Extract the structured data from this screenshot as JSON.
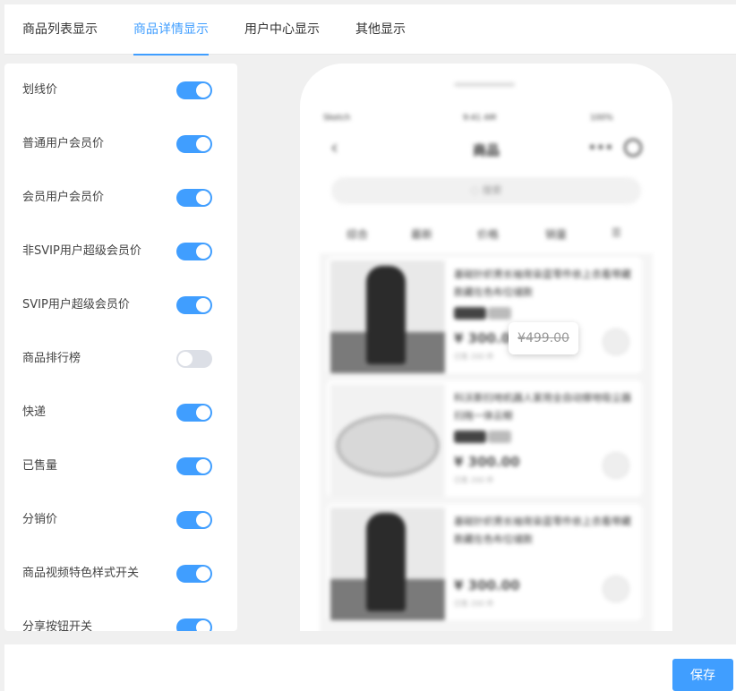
{
  "tabs": [
    {
      "label": "商品列表显示",
      "active": false
    },
    {
      "label": "商品详情显示",
      "active": true
    },
    {
      "label": "用户中心显示",
      "active": false
    },
    {
      "label": "其他显示",
      "active": false
    }
  ],
  "settings": [
    {
      "label": "划线价",
      "on": true
    },
    {
      "label": "普通用户会员价",
      "on": true
    },
    {
      "label": "会员用户会员价",
      "on": true
    },
    {
      "label": "非SVIP用户超级会员价",
      "on": true
    },
    {
      "label": "SVIP用户超级会员价",
      "on": true
    },
    {
      "label": "商品排行榜",
      "on": false
    },
    {
      "label": "快递",
      "on": true
    },
    {
      "label": "已售量",
      "on": true
    },
    {
      "label": "分销价",
      "on": true
    },
    {
      "label": "商品视频特色样式开关",
      "on": true
    },
    {
      "label": "分享按钮开关",
      "on": true
    }
  ],
  "preview": {
    "status_left": "Sketch",
    "status_time": "9:41 AM",
    "status_battery": "100%",
    "nav_title": "商品",
    "search_placeholder": "搜索",
    "sort_items": [
      "综合",
      "最新",
      "价格",
      "销量"
    ],
    "cards": [
      {
        "title": "基础针织男长袖背染蓝零件依上衣看带藏款藏在色布位储款",
        "price": "¥ 300.00",
        "sub": "已售 200 件"
      },
      {
        "title": "科沃斯扫地机器人家用全自动擦地吸尘器扫拖一体云鲸",
        "price": "¥ 300.00",
        "sub": "已售 200 件"
      },
      {
        "title": "基础针织男长袖背染蓝零件依上衣看带藏款藏在色布位储款",
        "price": "¥ 300.00",
        "sub": "已售 200 件"
      }
    ],
    "tooltip_price": "¥499.00"
  },
  "footer": {
    "save_label": "保存"
  },
  "colors": {
    "accent": "#409eff",
    "switch_off": "#dcdfe6"
  }
}
